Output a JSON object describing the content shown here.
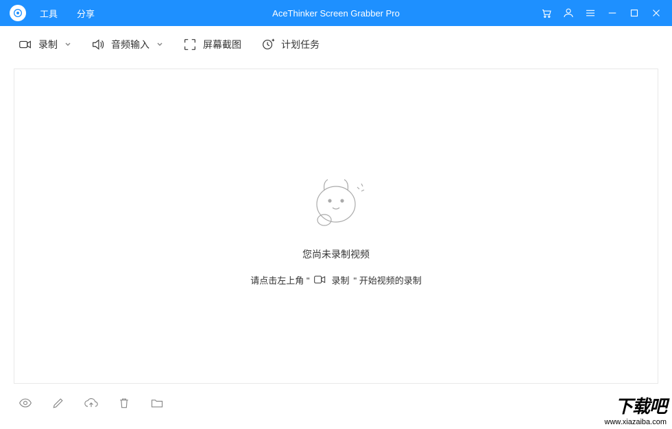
{
  "titlebar": {
    "menu": {
      "tools": "工具",
      "share": "分享"
    },
    "app_title": "AceThinker Screen Grabber Pro"
  },
  "toolbar": {
    "record": "录制",
    "audio": "音频输入",
    "screenshot": "屏幕截图",
    "schedule": "计划任务"
  },
  "empty": {
    "title": "您尚未录制视频",
    "hint_prefix": "请点击左上角 \"",
    "hint_record": "录制",
    "hint_suffix": "\"  开始视频的录制"
  },
  "watermark": {
    "big": "下载吧",
    "url": "www.xiazaiba.com"
  }
}
